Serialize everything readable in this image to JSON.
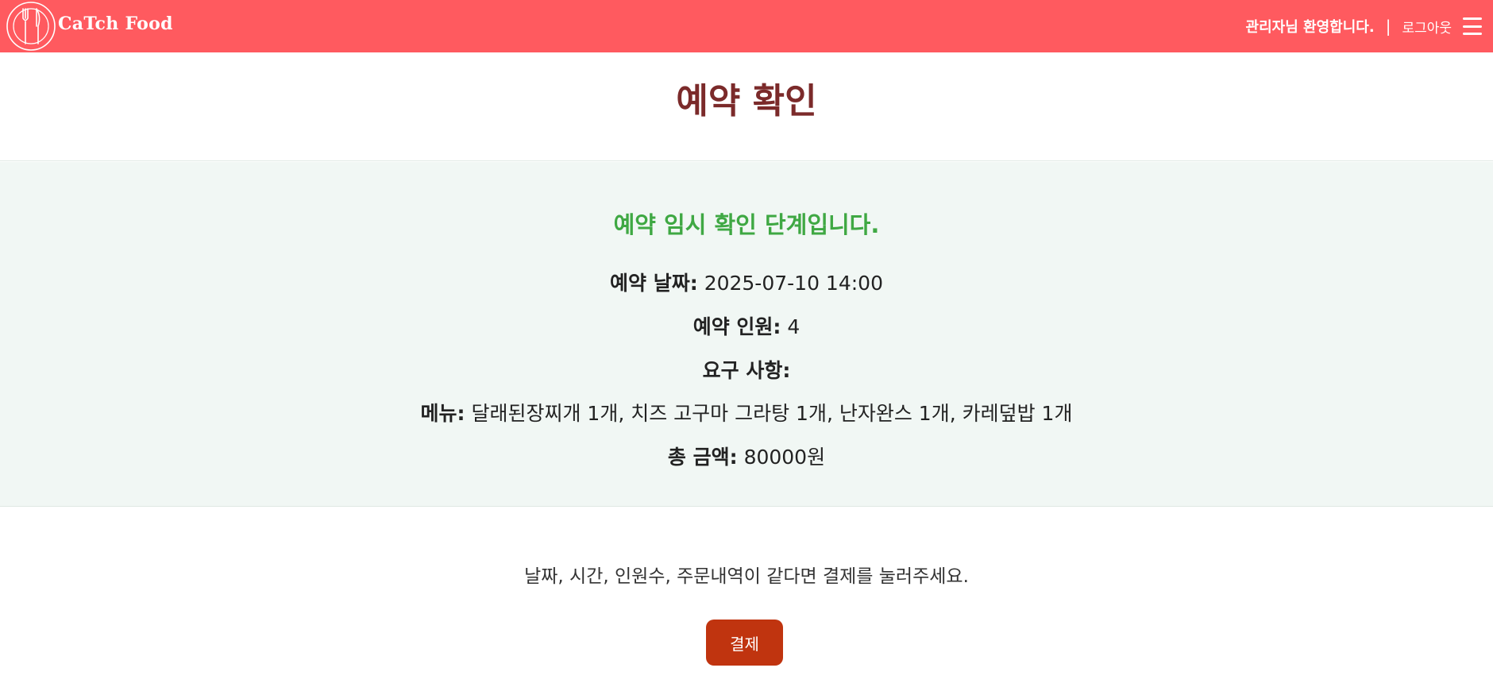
{
  "header": {
    "brand_name": "CaTch Food",
    "welcome_text": "관리자님 환영합니다.",
    "separator": "|",
    "logout_label": "로그아웃",
    "background_color": "#ff5a5f",
    "logo_icon": "fork-knife-plate-icon",
    "menu_icon": "hamburger-menu-icon"
  },
  "page": {
    "title": "예약 확인",
    "title_color": "#7b2a2a"
  },
  "confirmation": {
    "heading": "예약 임시 확인 단계입니다.",
    "heading_color": "#3fa843",
    "panel_background": "#f1f7f4",
    "fields": {
      "date": {
        "label": "예약 날짜:",
        "value": "2025-07-10 14:00"
      },
      "people": {
        "label": "예약 인원:",
        "value": "4"
      },
      "requests": {
        "label": "요구 사항:",
        "value": ""
      },
      "menu": {
        "label": "메뉴:",
        "value": "달래된장찌개 1개, 치즈 고구마 그라탕 1개, 난자완스 1개, 카레덮밥 1개"
      },
      "total": {
        "label": "총 금액:",
        "value": "80000원"
      }
    }
  },
  "footer": {
    "notice": "날짜, 시간, 인원수, 주문내역이 같다면 결제를 눌러주세요.",
    "pay_button_label": "결제",
    "pay_button_color": "#c0340f"
  }
}
